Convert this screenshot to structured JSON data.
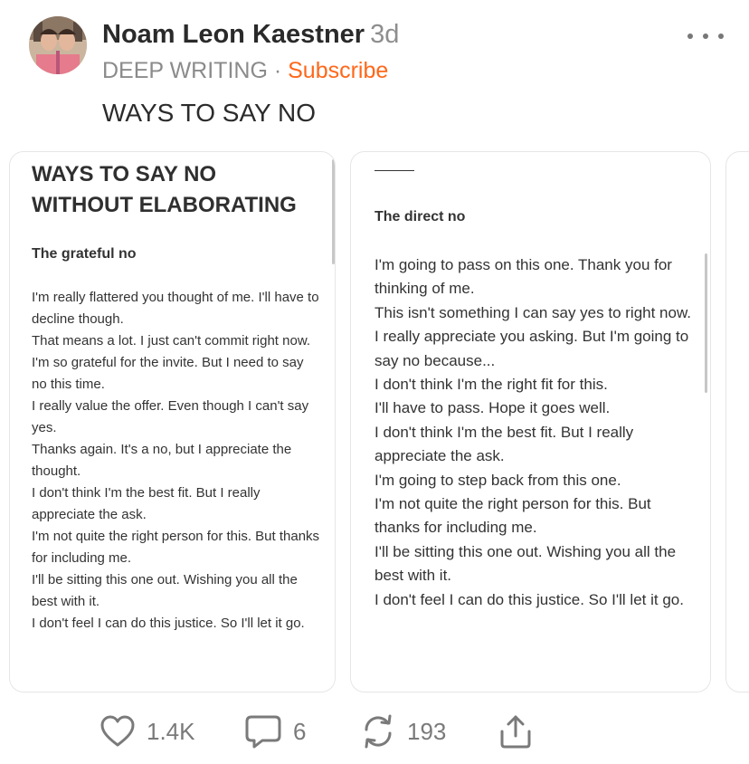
{
  "post": {
    "author": "Noam Leon Kaestner",
    "time": "3d",
    "publication": "DEEP WRITING",
    "separator": " · ",
    "subscribe_label": "Subscribe",
    "text": "WAYS TO SAY NO"
  },
  "cards": [
    {
      "title": "WAYS TO SAY NO WITHOUT ELABORATING",
      "section": "The grateful no",
      "lines": [
        "I'm really flattered you thought of me. I'll have to decline though.",
        "That means a lot. I just can't commit right now.",
        "I'm so grateful for the invite. But I need to say no this time.",
        "I really value the offer. Even though I can't say yes.",
        "Thanks again. It's a no, but I appreciate the thought.",
        "I don't think I'm the best fit. But I really appreciate the ask.",
        "I'm not quite the right person for this. But thanks for including me.",
        "I'll be sitting this one out. Wishing you all the best with it.",
        "I don't feel I can do this justice. So I'll let it go."
      ]
    },
    {
      "section": "The direct no",
      "lines": [
        "I'm going to pass on this one. Thank you for thinking of me.",
        "This isn't something I can say yes to right now.",
        "I really appreciate you asking. But I'm going to say no because...",
        "I don't think I'm the right fit for this.",
        "I'll have to pass. Hope it goes well.",
        "I don't think I'm the best fit. But I really appreciate the ask.",
        "I'm going to step back from this one.",
        "I'm not quite the right person for this. But thanks for including me.",
        "I'll be sitting this one out. Wishing you all the best with it.",
        "I don't feel I can do this justice. So I'll let it go."
      ]
    }
  ],
  "actions": {
    "likes": "1.4K",
    "comments": "6",
    "restacks": "193"
  },
  "icons": {
    "like": "heart-icon",
    "comment": "comment-icon",
    "restack": "restack-icon",
    "share": "share-icon",
    "more": "more-icon"
  },
  "colors": {
    "accent": "#ff6719",
    "muted_text": "#8b8b8b",
    "card_border": "#e6e6e6"
  }
}
